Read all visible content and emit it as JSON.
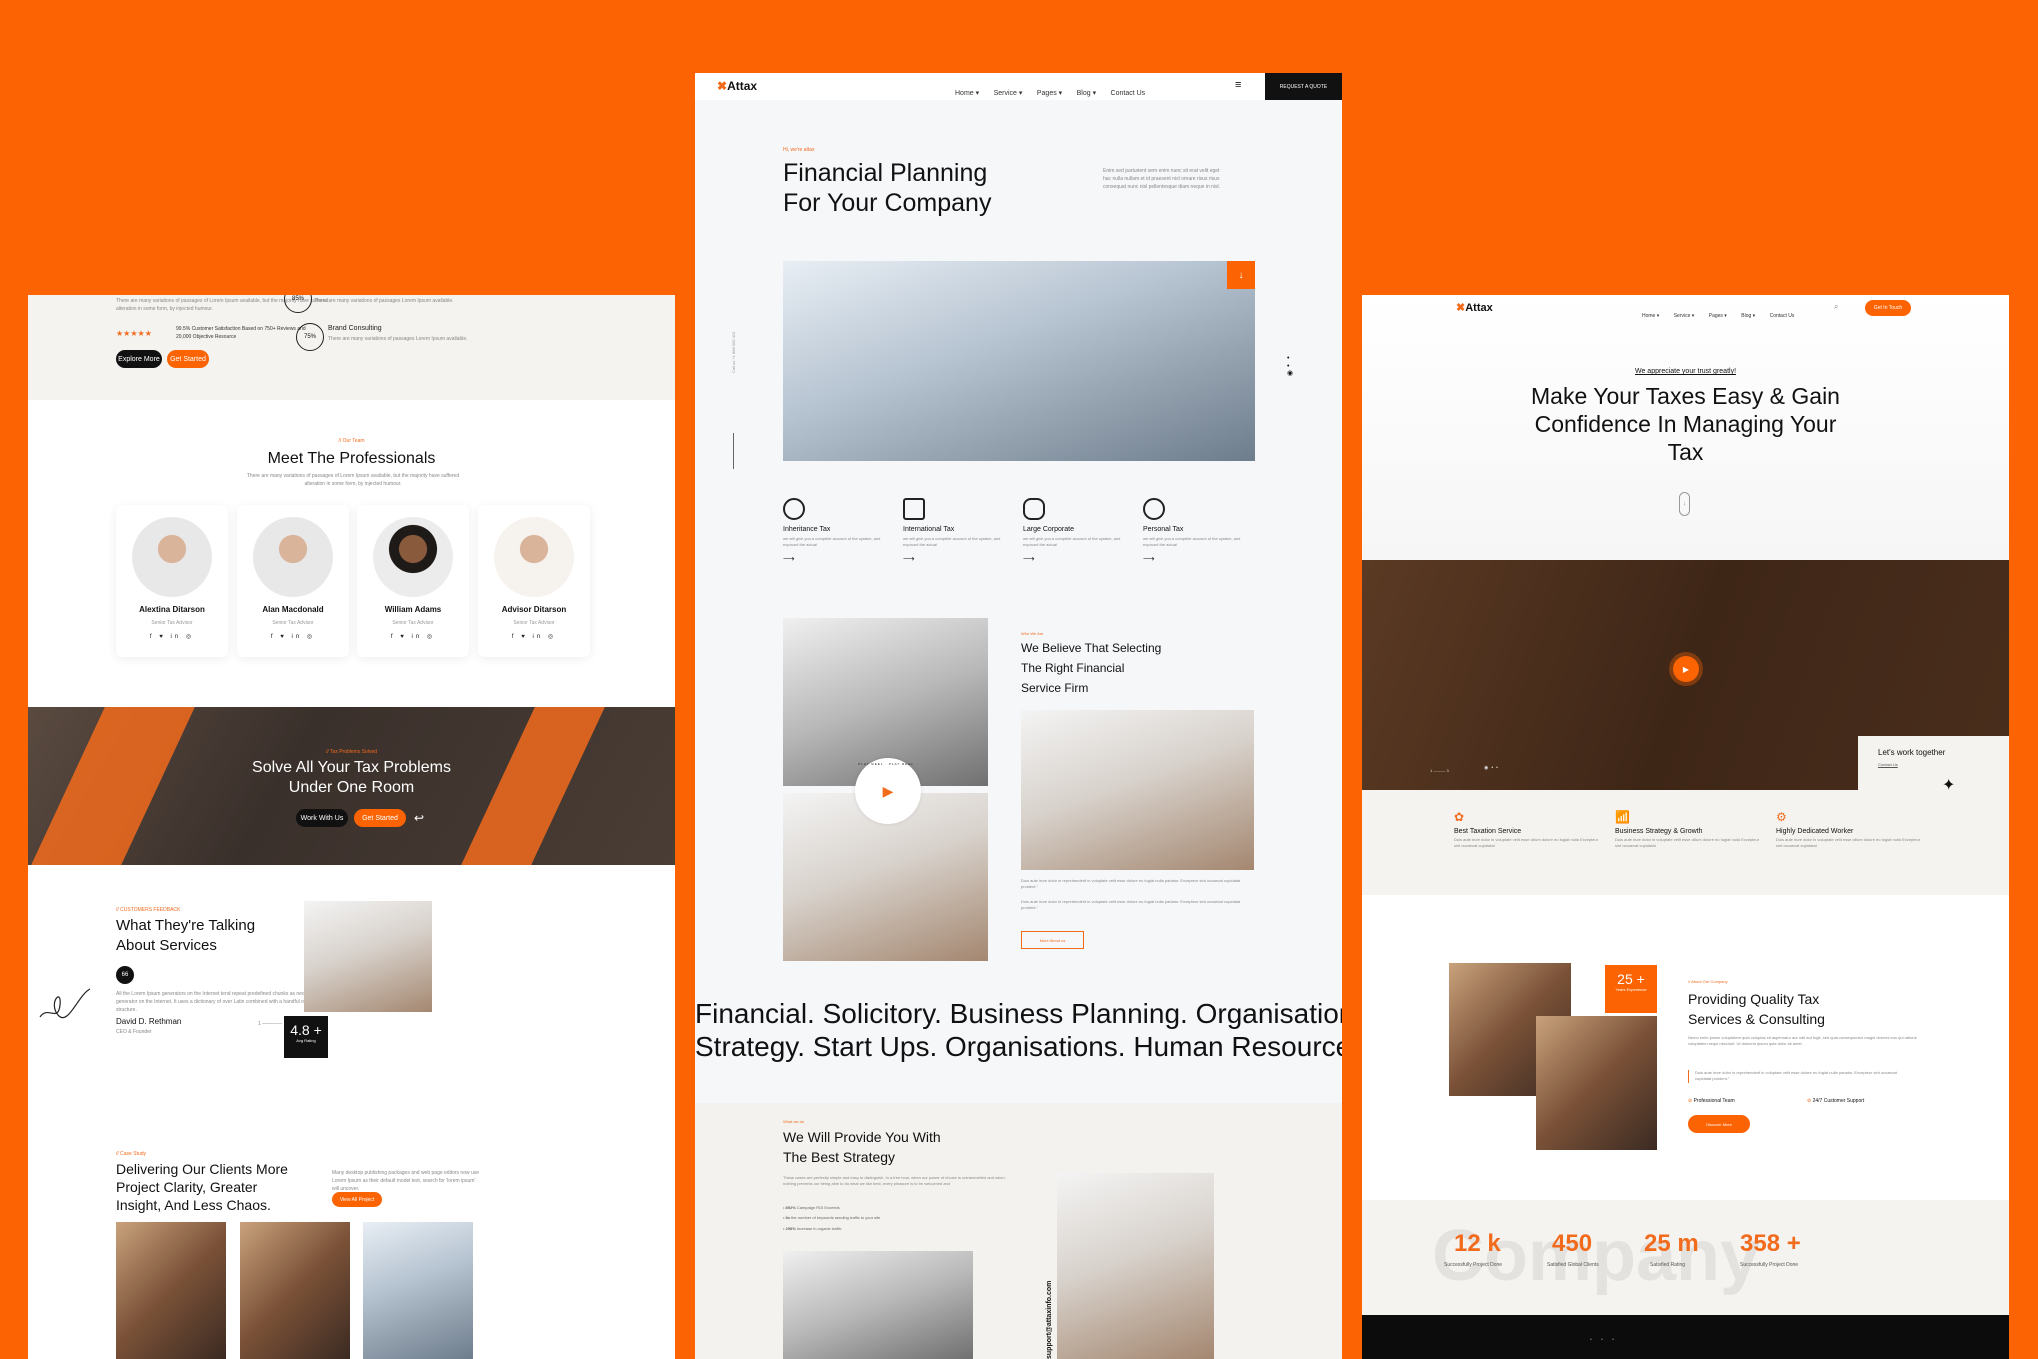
{
  "brand": {
    "name": "Attax",
    "accent": "#fb6303",
    "dark": "#111111"
  },
  "left": {
    "about": {
      "paragraph": "There are many variations of passages of Lorem Ipsum available, but the majority have suffered alteration in some form, by injected humour.",
      "stars": "★★★★★",
      "satisfaction": "99.5% Customer Satisfaction Based on 750+ Reviews and 20,000 Objective Resource",
      "explore_btn": "Explore More",
      "started_btn": "Get Started",
      "progress": [
        {
          "value": "85%",
          "title": "",
          "desc": "There are many variations of passages Lorem Ipsum available."
        },
        {
          "value": "75%",
          "title": "Brand Consulting",
          "desc": "There are many variations of passages Lorem Ipsum available."
        }
      ]
    },
    "team": {
      "eyebrow": "// Our Team",
      "title": "Meet The Professionals",
      "subtitle": "There are many variations of passages of Lorem Ipsum available, but the majority have suffered alteration in some form, by injected humour.",
      "members": [
        {
          "name": "Alextina Ditarson",
          "role": "Senior Tax Advisor"
        },
        {
          "name": "Alan Macdonald",
          "role": "Senior Tax Advisor"
        },
        {
          "name": "William Adams",
          "role": "Senior Tax Advisor"
        },
        {
          "name": "Advisor Ditarson",
          "role": "Senior Tax Advisor"
        }
      ],
      "social": "f ♥ in ◎"
    },
    "cta": {
      "eyebrow": "// Tax Problems Solved",
      "title_l1": "Solve All Your Tax Problems",
      "title_l2": "Under One Room",
      "work_btn": "Work With Us",
      "start_btn": "Get Started"
    },
    "testimonial": {
      "eyebrow": "// CUSTOMERS FEEDBACK",
      "title_l1": "What They're Talking",
      "title_l2": "About Services",
      "quote_icon": "66",
      "text": "All the Lorem Ipsum generators on the Internet tend repeat predefined chunks as necessary, making this the generator on the Internet. It uses a dictionary of over Latin combined with a handful of model sentence structure.",
      "author": "David D. Rethman",
      "author_role": "CEO & Founder",
      "pager_start": "1",
      "pager_end": "3",
      "rating": "4.8 +",
      "rating_label": "Avg Rating"
    },
    "case": {
      "eyebrow": "// Case Study",
      "title_l1": "Delivering Our Clients More",
      "title_l2": "Project Clarity, Greater",
      "title_l3": "Insight, And Less Chaos.",
      "desc": "Many desktop publishing packages and web page editors now use Lorem Ipsum as their default model text, search for 'lorem ipsum' will uncover.",
      "btn": "View All Project"
    }
  },
  "middle": {
    "nav": {
      "items": [
        "Home ▾",
        "Service ▾",
        "Pages ▾",
        "Blog ▾",
        "Contact Us"
      ],
      "quote_btn": "REQUEST A QUOTE"
    },
    "hero": {
      "eyebrow": "Hi, we're attax",
      "title_l1": "Financial Planning",
      "title_l2": "For Your Company",
      "desc": "Enim sed parturient sem enim nunc sit erat velit eget hac nulla nullam et id praesent nisl ornare risus risus consequat nunc nisl pellentesque diam neque in nisl.",
      "call": "Call us +1 888 000 420"
    },
    "services": [
      {
        "title": "Inheritance Tax",
        "desc": "we will give you a complete account of the system, and expound the actual"
      },
      {
        "title": "International Tax",
        "desc": "we will give you a complete account of the system, and expound the actual"
      },
      {
        "title": "Large Corporate",
        "desc": "we will give you a complete account of the system, and expound the actual"
      },
      {
        "title": "Personal Tax",
        "desc": "we will give you a complete account of the system, and expound the actual"
      }
    ],
    "who": {
      "eyebrow": "Who We Are",
      "title_l1": "We Believe That Selecting",
      "title_l2": "The Right Financial",
      "title_l3": "Service Firm",
      "p1": "Duis aute irure dolor in reprehenderit in voluptate velit esse dolore eu fugiat nulla pariatur. Excepteur sint occaecat cupidatat proident.\"",
      "p2": "Duis aute irure dolor in reprehenderit in voluptate velit esse dolore eu fugiat nulla pariatur. Excepteur sint occaecat cupidatat proident.\"",
      "btn": "More About us",
      "play_text": "PLAY REEL · PLAY REEL ·"
    },
    "marquee": {
      "line1": "Financial.  Solicitory.  Business Planning.  Organisations.",
      "line2": "Strategy.  Start Ups.  Organisations.  Human Resources."
    },
    "whatwedo": {
      "eyebrow": "What we do",
      "title_l1": "We Will Provide You With",
      "title_l2": "The Best Strategy",
      "desc": "These cases are perfectly simple and easy to distinguish. In a free hour, when our power of choice is untrammelled and when nothing prevents our being able to do what we like best, every pleasure is to be welcomed and",
      "bullets": [
        {
          "strong": "892%",
          "text": " Campaign ROI Exceeds"
        },
        {
          "strong": "8x",
          "text": " the number of keywords sending traffic to your site"
        },
        {
          "strong": "298%",
          "text": " Increase in organic traffic"
        }
      ],
      "email": "support@attaxinfo.com"
    }
  },
  "right": {
    "nav": {
      "items": [
        "Home ▾",
        "Service ▾",
        "Pages ▾",
        "Blog ▾",
        "Contact Us"
      ],
      "cta": "Get In Touch"
    },
    "hero": {
      "eyebrow": "We appreciate your trust greatly!",
      "title_l1": "Make Your Taxes Easy & Gain",
      "title_l2": "Confidence In Managing Your",
      "title_l3": "Tax"
    },
    "video": {
      "pager_start": "1",
      "pager_end": "3",
      "work_title": "Let's work together",
      "contact_link": "Contact Us"
    },
    "features": [
      {
        "title": "Best Taxation Service",
        "desc": "Duis aute irure dolor in voluptate velit esse cillum dolore eu fugiat nulla Excepteur sint occaecat cupidatat"
      },
      {
        "title": "Business Strategy & Growth",
        "desc": "Duis aute irure dolor in voluptate velit esse cillum dolore eu fugiat nulla Excepteur sint occaecat cupidatat"
      },
      {
        "title": "Highly Dedicated Worker",
        "desc": "Duis aute irure dolor in voluptate velit esse cillum dolore eu fugiat nulla Excepteur sint occaecat cupidatat"
      }
    ],
    "about": {
      "years": "25 +",
      "years_label": "Years Experience",
      "eyebrow": "// About Our Company",
      "title_l1": "Providing Quality Tax",
      "title_l2": "Services & Consulting",
      "desc": "Nemo enim ipsam voluptatem quia voluptas sit aspernatur aut odit aut fugit, sed quia consequuntur magni dolores eos qui ratione voluptatem sequi nesciunt. Ut dolorem ipsum quia dolor sit amet.",
      "quote": "Duis aute irure dolor in reprehenderit in voluptate velit esse dolore eu fugiat nulla pariatur. Excepteur sint occaecat cupidatat proident.\"",
      "check1": "Professional Team",
      "check2": "24/7 Customer Support",
      "btn": "Discover More"
    },
    "stats": {
      "watermark": "Company",
      "items": [
        {
          "value": "12 k",
          "label": "Successfully Project Done"
        },
        {
          "value": "450",
          "label": "Satisfied Global Clients"
        },
        {
          "value": "25 m",
          "label": "Satisfied Rating"
        },
        {
          "value": "358 +",
          "label": "Successfully Project Done"
        }
      ]
    }
  }
}
